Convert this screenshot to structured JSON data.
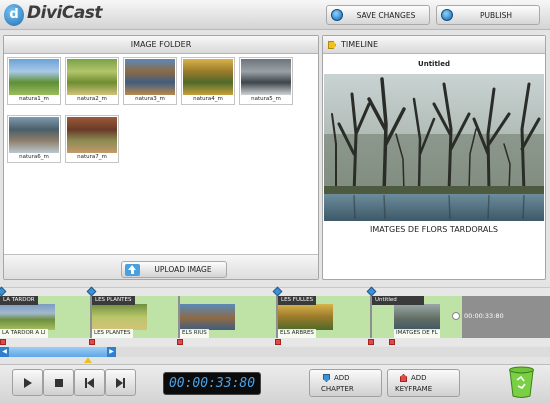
{
  "app": {
    "logo_glyph": "d",
    "name": "DiviCast"
  },
  "header": {
    "save_label": "SAVE CHANGES",
    "publish_label": "PUBLISH"
  },
  "image_folder": {
    "title": "IMAGE FOLDER",
    "images": [
      {
        "name": "natura1_m",
        "colors": [
          "#6aa3d6",
          "#a9c9e6",
          "#5e8f36",
          "#9bbd5e"
        ]
      },
      {
        "name": "natura2_m",
        "colors": [
          "#7aa24a",
          "#b3c56a",
          "#6e8d32",
          "#d1c27a"
        ]
      },
      {
        "name": "natura3_m",
        "colors": [
          "#5c89b8",
          "#8c6a45",
          "#3f5e80",
          "#b8894c"
        ]
      },
      {
        "name": "natura4_m",
        "colors": [
          "#d9b24a",
          "#9a7a2a",
          "#4f6a2a",
          "#c6a03a"
        ]
      },
      {
        "name": "natura5_m",
        "colors": [
          "#6d757c",
          "#9aa1a6",
          "#3e454b",
          "#cfd3d6"
        ]
      },
      {
        "name": "natura6_m",
        "colors": [
          "#7e9aae",
          "#4a5f6a",
          "#8c7d6a",
          "#bcc8cf"
        ]
      },
      {
        "name": "natura7_m",
        "colors": [
          "#9c5a3a",
          "#6a3a28",
          "#8a8a52",
          "#c29a6a"
        ]
      }
    ],
    "upload_label": "UPLOAD IMAGE"
  },
  "timeline": {
    "title": "TIMELINE",
    "project_title": "Untitled",
    "preview_caption": "IMATGES DE FLORS TARDORALS"
  },
  "track": {
    "clips": [
      {
        "top": "LA TARDOR",
        "bottom": "LA TARDOR A LI"
      },
      {
        "top": "LES PLANTES",
        "bottom": "LES PLANTES"
      },
      {
        "top": "",
        "bottom": "ELS RIUS"
      },
      {
        "top": "LES FULLES",
        "bottom": "ELS ARBRES"
      },
      {
        "top": "Untitled",
        "bottom": "IMATGES DE FL"
      }
    ],
    "end_time": "00:00:33:80"
  },
  "controls": {
    "timecode": "00:00:33:80",
    "add_chapter_label": [
      "ADD",
      "CHAPTER"
    ],
    "add_keyframe_label": [
      "ADD",
      "KEYFRAME"
    ]
  },
  "colors": {
    "accent": "#1d6fb5",
    "clip_bg": "#bfe3a6",
    "timecode_text": "#4aa3e8",
    "keyframe": "#e24a4a"
  }
}
